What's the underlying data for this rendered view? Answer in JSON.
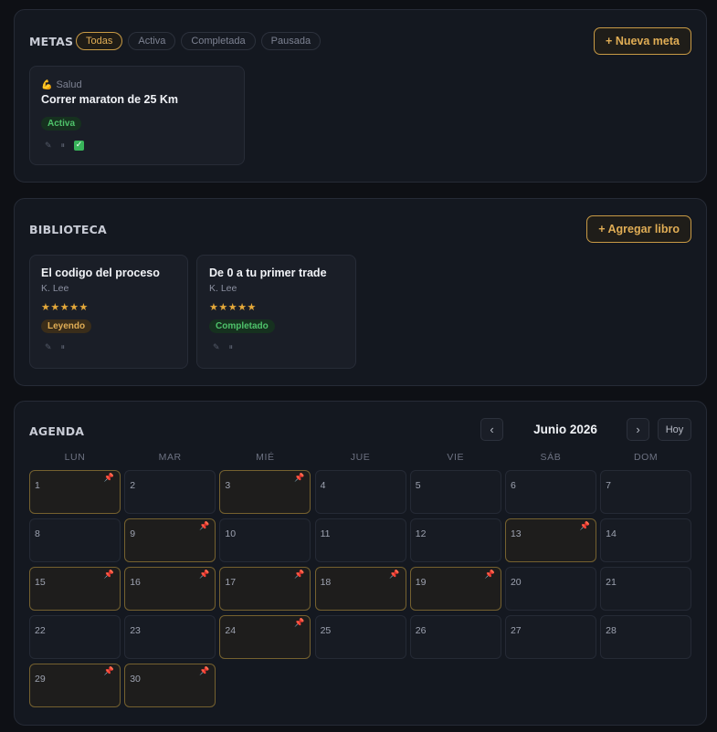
{
  "metas": {
    "title": "METAS",
    "filters": [
      "Todas",
      "Activa",
      "Completada",
      "Pausada"
    ],
    "active_filter": "Todas",
    "add_button": "+ Nueva meta",
    "cards": [
      {
        "emoji": "💪",
        "category": "Salud",
        "title": "Correr maraton de 25 Km",
        "status": "Activa"
      }
    ]
  },
  "biblioteca": {
    "title": "BIBLIOTECA",
    "add_button": "+ Agregar libro",
    "books": [
      {
        "title": "El codigo del proceso",
        "author": "K. Lee",
        "rating": 5,
        "stars": "★★★★★",
        "status": "Leyendo"
      },
      {
        "title": "De 0 a tu primer trade",
        "author": "K. Lee",
        "rating": 5,
        "stars": "★★★★★",
        "status": "Completado"
      }
    ]
  },
  "agenda": {
    "title": "AGENDA",
    "month": "Junio 2026",
    "prev": "‹",
    "next": "›",
    "today_button": "Hoy",
    "weekdays": [
      "LUN",
      "MAR",
      "MIÉ",
      "JUE",
      "VIE",
      "SÁB",
      "DOM"
    ],
    "days": [
      "1",
      "2",
      "3",
      "4",
      "5",
      "6",
      "7",
      "8",
      "9",
      "10",
      "11",
      "12",
      "13",
      "14",
      "15",
      "16",
      "17",
      "18",
      "19",
      "20",
      "21",
      "22",
      "23",
      "24",
      "25",
      "26",
      "27",
      "28",
      "29",
      "30"
    ],
    "days_with_events": [
      1,
      3,
      9,
      13,
      15,
      16,
      17,
      18,
      19,
      24,
      29,
      30
    ]
  },
  "colors": {
    "accent": "#e0ad55",
    "event_pin": "#e0427a",
    "active_badge": "#4fc36b"
  },
  "icons": {
    "edit": "pencil-icon",
    "pause": "pause-icon",
    "complete": "checkbox-icon",
    "event": "pushpin-icon"
  }
}
